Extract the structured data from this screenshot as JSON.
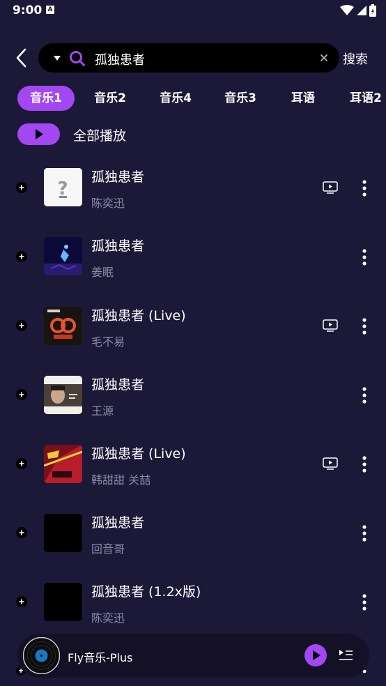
{
  "status": {
    "time": "9:00",
    "badge": "A"
  },
  "search": {
    "query": "孤独患者",
    "action_label": "搜索"
  },
  "tabs": [
    {
      "label": "音乐1",
      "active": true
    },
    {
      "label": "音乐2",
      "active": false
    },
    {
      "label": "音乐4",
      "active": false
    },
    {
      "label": "音乐3",
      "active": false
    },
    {
      "label": "耳语",
      "active": false
    },
    {
      "label": "耳语2",
      "active": false
    }
  ],
  "play_all_label": "全部播放",
  "songs": [
    {
      "title": "孤独患者",
      "artist": "陈奕迅",
      "cover": "cover-chen-yixun",
      "has_mv": true
    },
    {
      "title": "孤独患者",
      "artist": "姜眠",
      "cover": "cover-blue-figure",
      "has_mv": false
    },
    {
      "title": "孤独患者 (Live)",
      "artist": "毛不易",
      "cover": "cover-sheng-sheng-bu-xi",
      "has_mv": true
    },
    {
      "title": "孤独患者",
      "artist": "王源",
      "cover": "cover-wang-yuan",
      "has_mv": false
    },
    {
      "title": "孤独患者 (Live)",
      "artist": "韩甜甜 关喆",
      "cover": "cover-red-show",
      "has_mv": true
    },
    {
      "title": "孤独患者",
      "artist": "回音哥",
      "cover": "cover-black",
      "has_mv": false
    },
    {
      "title": "孤独患者 (1.2x版)",
      "artist": "陈奕迅",
      "cover": "cover-black",
      "has_mv": false
    }
  ],
  "player": {
    "title": "Fly音乐-Plus"
  },
  "colors": {
    "background": "#1c1838",
    "accent": "#a347f2",
    "secondary_text": "#8d8aa6",
    "search_bg": "#000000",
    "player_bg": "#141126"
  }
}
